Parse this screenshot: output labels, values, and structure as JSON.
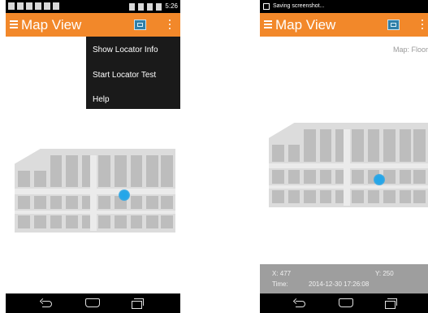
{
  "left_screen": {
    "status_bar": {
      "time": "5:26"
    },
    "app_bar": {
      "title": "Map View"
    },
    "overflow_menu": {
      "items": [
        {
          "label": "Show Locator Info"
        },
        {
          "label": "Start Locator Test"
        },
        {
          "label": "Help"
        }
      ]
    }
  },
  "right_screen": {
    "status_bar": {
      "notification": "Saving screenshot..."
    },
    "app_bar": {
      "title": "Map View"
    },
    "floor_label": "Map: Floor",
    "locator_info": {
      "x_label": "X: 477",
      "y_label": "Y: 250",
      "time_label": "Time:",
      "time_value": "2014-12-30 17:26:08"
    }
  },
  "colors": {
    "app_bar": "#f2882a",
    "location_dot": "#2ba6e6",
    "menu_background": "#1a1a1a",
    "status_bar": "#000000"
  },
  "icons": [
    "menu-icon",
    "map-icon",
    "overflow-icon",
    "back-icon",
    "home-icon",
    "recents-icon"
  ]
}
